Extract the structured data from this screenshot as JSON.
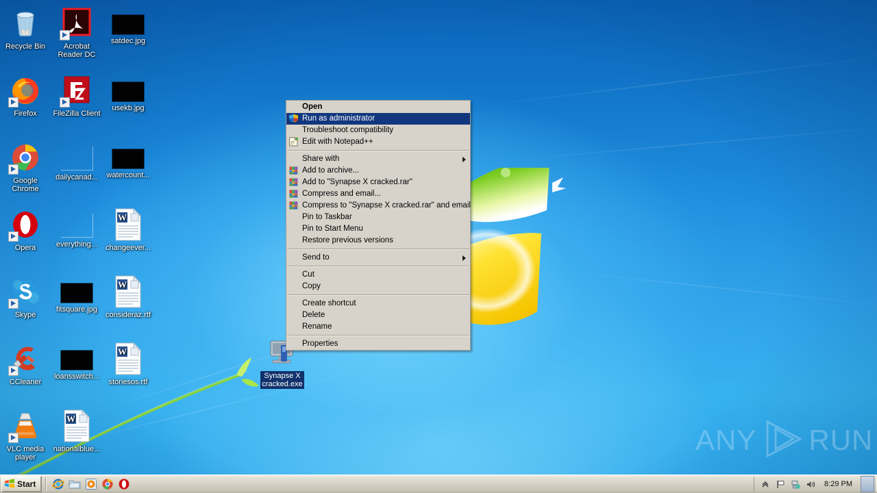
{
  "desktop": {
    "wallpaper_name": "windows-7-harmony-wallpaper",
    "accent_blue": "#1f8ede",
    "icons": [
      {
        "label": "Recycle Bin",
        "art": "recycle-bin",
        "shortcut": false
      },
      {
        "label": "Acrobat Reader DC",
        "art": "acrobat",
        "shortcut": true
      },
      {
        "label": "satdec.jpg",
        "art": "black-thumb",
        "shortcut": false
      },
      {
        "label": "Firefox",
        "art": "firefox",
        "shortcut": true
      },
      {
        "label": "FileZilla Client",
        "art": "filezilla",
        "shortcut": true
      },
      {
        "label": "usekb.jpg",
        "art": "black-thumb",
        "shortcut": false
      },
      {
        "label": "Google Chrome",
        "art": "chrome",
        "shortcut": true
      },
      {
        "label": "dailycanad...",
        "art": "blank-thumb",
        "shortcut": false
      },
      {
        "label": "watercount...",
        "art": "black-thumb",
        "shortcut": false
      },
      {
        "label": "Opera",
        "art": "opera",
        "shortcut": true
      },
      {
        "label": "everything...",
        "art": "blank-thumb",
        "shortcut": false
      },
      {
        "label": "changeever...",
        "art": "word-doc",
        "shortcut": false
      },
      {
        "label": "Skype",
        "art": "skype",
        "shortcut": true
      },
      {
        "label": "fitsquare.jpg",
        "art": "black-thumb",
        "shortcut": false
      },
      {
        "label": "consideraz.rtf",
        "art": "word-doc",
        "shortcut": false
      },
      {
        "label": "CCleaner",
        "art": "ccleaner",
        "shortcut": true
      },
      {
        "label": "loansswitch...",
        "art": "black-thumb",
        "shortcut": false
      },
      {
        "label": "storiesos.rtf",
        "art": "word-doc",
        "shortcut": false
      },
      {
        "label": "VLC media player",
        "art": "vlc",
        "shortcut": true
      },
      {
        "label": "nationalblue...",
        "art": "word-doc",
        "shortcut": false
      }
    ],
    "selected_file": {
      "label_line1": "Synapse X",
      "label_line2": "cracked.exe",
      "icon": "generic-exe-icon",
      "selection_color": "#10316b"
    },
    "watermark": {
      "text_left": "ANY",
      "text_right": "RUN",
      "icon": "play-triangle-icon"
    }
  },
  "context_menu": {
    "items": [
      {
        "label": "Open",
        "type": "item",
        "bold": true,
        "selected": false,
        "icon": "none",
        "submenu": false
      },
      {
        "label": "Run as administrator",
        "type": "item",
        "bold": false,
        "selected": true,
        "icon": "uac-shield-icon",
        "submenu": false
      },
      {
        "label": "Troubleshoot compatibility",
        "type": "item",
        "bold": false,
        "selected": false,
        "icon": "none",
        "submenu": false
      },
      {
        "label": "Edit with Notepad++",
        "type": "item",
        "bold": false,
        "selected": false,
        "icon": "notepadpp-icon",
        "submenu": false
      },
      {
        "label": "",
        "type": "separator"
      },
      {
        "label": "Share with",
        "type": "item",
        "bold": false,
        "selected": false,
        "icon": "none",
        "submenu": true
      },
      {
        "label": "Add to archive...",
        "type": "item",
        "bold": false,
        "selected": false,
        "icon": "winrar-icon",
        "submenu": false
      },
      {
        "label": "Add to \"Synapse X cracked.rar\"",
        "type": "item",
        "bold": false,
        "selected": false,
        "icon": "winrar-icon",
        "submenu": false
      },
      {
        "label": "Compress and email...",
        "type": "item",
        "bold": false,
        "selected": false,
        "icon": "winrar-icon",
        "submenu": false
      },
      {
        "label": "Compress to \"Synapse X cracked.rar\" and email",
        "type": "item",
        "bold": false,
        "selected": false,
        "icon": "winrar-icon",
        "submenu": false
      },
      {
        "label": "Pin to Taskbar",
        "type": "item",
        "bold": false,
        "selected": false,
        "icon": "none",
        "submenu": false
      },
      {
        "label": "Pin to Start Menu",
        "type": "item",
        "bold": false,
        "selected": false,
        "icon": "none",
        "submenu": false
      },
      {
        "label": "Restore previous versions",
        "type": "item",
        "bold": false,
        "selected": false,
        "icon": "none",
        "submenu": false
      },
      {
        "label": "",
        "type": "separator"
      },
      {
        "label": "Send to",
        "type": "item",
        "bold": false,
        "selected": false,
        "icon": "none",
        "submenu": true
      },
      {
        "label": "",
        "type": "separator"
      },
      {
        "label": "Cut",
        "type": "item",
        "bold": false,
        "selected": false,
        "icon": "none",
        "submenu": false
      },
      {
        "label": "Copy",
        "type": "item",
        "bold": false,
        "selected": false,
        "icon": "none",
        "submenu": false
      },
      {
        "label": "",
        "type": "separator"
      },
      {
        "label": "Create shortcut",
        "type": "item",
        "bold": false,
        "selected": false,
        "icon": "none",
        "submenu": false
      },
      {
        "label": "Delete",
        "type": "item",
        "bold": false,
        "selected": false,
        "icon": "none",
        "submenu": false
      },
      {
        "label": "Rename",
        "type": "item",
        "bold": false,
        "selected": false,
        "icon": "none",
        "submenu": false
      },
      {
        "label": "",
        "type": "separator"
      },
      {
        "label": "Properties",
        "type": "item",
        "bold": false,
        "selected": false,
        "icon": "none",
        "submenu": false
      }
    ],
    "highlight_color": "#12377e",
    "background_color": "#d7d3cb"
  },
  "taskbar": {
    "start_label": "Start",
    "start_icon": "windows-flag-icon",
    "quick_launch": [
      {
        "name": "internet-explorer-icon",
        "title": "Internet Explorer"
      },
      {
        "name": "windows-explorer-icon",
        "title": "Windows Explorer"
      },
      {
        "name": "media-player-icon",
        "title": "Windows Media Player"
      },
      {
        "name": "google-chrome-icon",
        "title": "Google Chrome"
      },
      {
        "name": "opera-icon",
        "title": "Opera"
      }
    ],
    "tray": [
      {
        "name": "show-hidden-icons-icon",
        "glyph": "«"
      },
      {
        "name": "action-flag-icon",
        "glyph": "flag"
      },
      {
        "name": "network-icon",
        "glyph": "network"
      },
      {
        "name": "volume-icon",
        "glyph": "speaker"
      }
    ],
    "clock": "8:29 PM",
    "show_desktop_label": ""
  }
}
